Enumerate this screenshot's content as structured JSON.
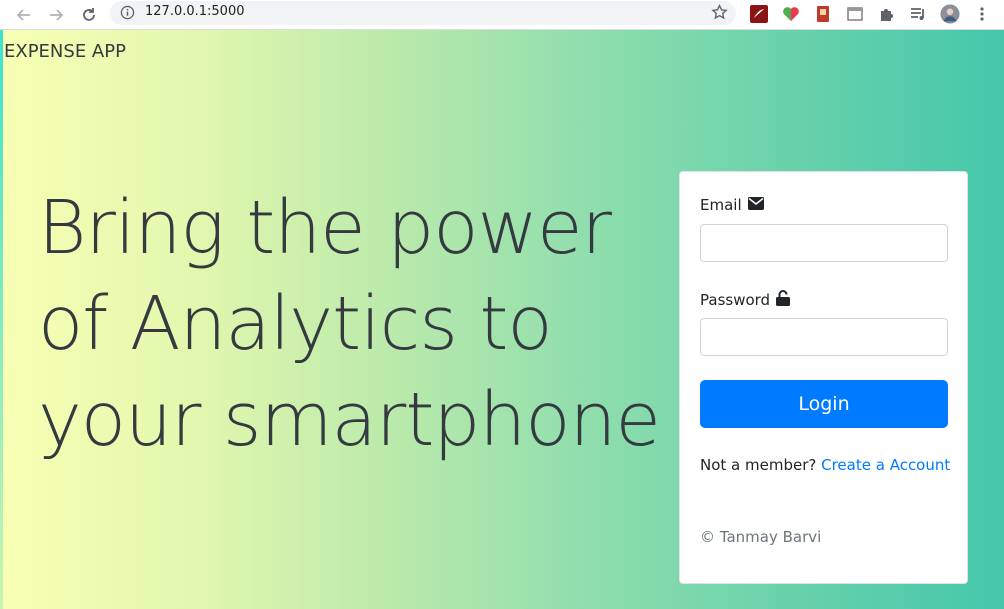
{
  "browser": {
    "url": "127.0.0.1:5000",
    "icons": [
      "back-arrow-icon",
      "forward-arrow-icon",
      "reload-icon",
      "info-icon",
      "bookmark-star-icon",
      "acrobat-extension-icon",
      "heart-extension-icon",
      "p-extension-icon",
      "tab-extension-icon",
      "puzzle-extensions-icon",
      "reading-list-icon",
      "profile-avatar-icon",
      "more-menu-icon"
    ]
  },
  "navbar": {
    "brand": "EXPENSE APP"
  },
  "hero": {
    "line1": "Bring the power",
    "line2": "of Analytics to",
    "line3": "your smartphone"
  },
  "login_form": {
    "email_label": "Email",
    "email_value": "",
    "password_label": "Password",
    "password_value": "",
    "login_button": "Login",
    "member_prompt": "Not a member?",
    "create_account_link": "Create a Account",
    "copyright": "© Tanmay Barvi"
  },
  "colors": {
    "primary": "#007bff",
    "gradient_start": "#f8ffb4",
    "gradient_end": "#45c7ab",
    "text_dark": "#343a40"
  }
}
